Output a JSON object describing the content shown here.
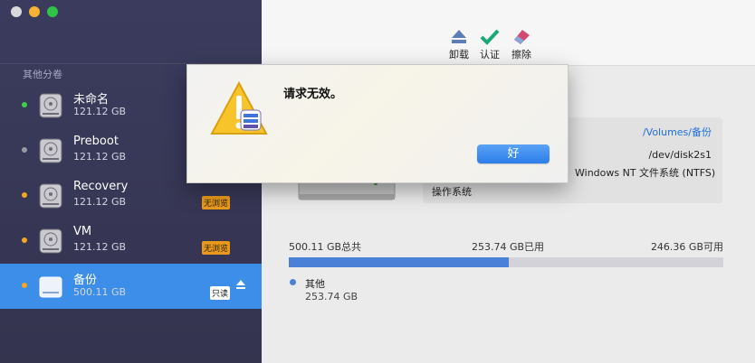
{
  "sidebar": {
    "section_label": "其他分卷",
    "volumes": [
      {
        "name": "未命名",
        "size": "121.12 GB",
        "dot_color": "#3ed04a",
        "badge": ""
      },
      {
        "name": "Preboot",
        "size": "121.12 GB",
        "dot_color": "#9a9aa6",
        "badge": ""
      },
      {
        "name": "Recovery",
        "size": "121.12 GB",
        "dot_color": "#f5a623",
        "badge": "无浏览"
      },
      {
        "name": "VM",
        "size": "121.12 GB",
        "dot_color": "#f5a623",
        "badge": "无浏览"
      },
      {
        "name": "备份",
        "size": "500.11 GB",
        "dot_color": "#f5a623",
        "badge": "只读"
      }
    ]
  },
  "toolbar": {
    "unmount_label": "卸载",
    "verify_label": "认证",
    "erase_label": "擦除"
  },
  "info": {
    "mount_point": "/Volumes/备份",
    "device": "/dev/disk2s1",
    "filesystem": "Windows NT 文件系统 (NTFS)",
    "os_label": "操作系统"
  },
  "capacity": {
    "total": "500.11 GB总共",
    "used": "253.74 GB已用",
    "free": "246.36 GB可用",
    "used_fraction": 0.507,
    "legend_name": "其他",
    "legend_value": "253.74 GB"
  },
  "dialog": {
    "message": "请求无效。",
    "ok_label": "好"
  },
  "colors": {
    "accent": "#3d8ee8",
    "bar": "#4a80d6"
  }
}
